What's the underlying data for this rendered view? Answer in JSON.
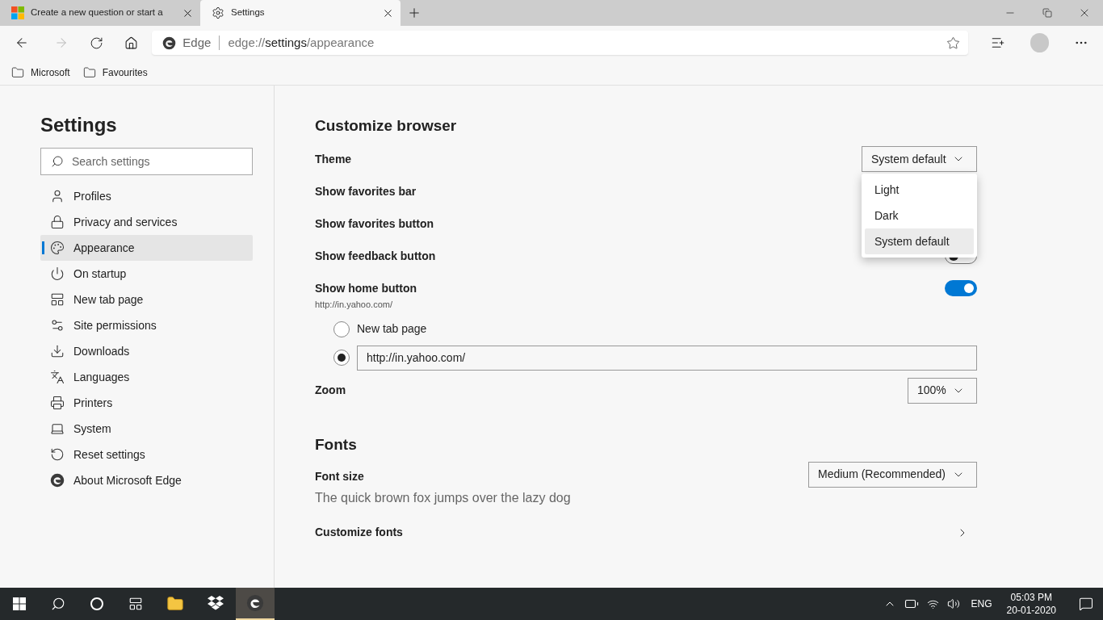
{
  "tabs": [
    {
      "title": "Create a new question or start a",
      "selected": false
    },
    {
      "title": "Settings",
      "selected": true
    }
  ],
  "address_bar": {
    "site_label": "Edge",
    "url_parts": [
      "edge://",
      "settings",
      "/appearance"
    ]
  },
  "favorites_bar": [
    "Microsoft",
    "Favourites"
  ],
  "sidebar": {
    "title": "Settings",
    "search_placeholder": "Search settings",
    "items": [
      {
        "label": "Profiles",
        "selected": false
      },
      {
        "label": "Privacy and services",
        "selected": false
      },
      {
        "label": "Appearance",
        "selected": true
      },
      {
        "label": "On startup",
        "selected": false
      },
      {
        "label": "New tab page",
        "selected": false
      },
      {
        "label": "Site permissions",
        "selected": false
      },
      {
        "label": "Downloads",
        "selected": false
      },
      {
        "label": "Languages",
        "selected": false
      },
      {
        "label": "Printers",
        "selected": false
      },
      {
        "label": "System",
        "selected": false
      },
      {
        "label": "Reset settings",
        "selected": false
      },
      {
        "label": "About Microsoft Edge",
        "selected": false
      }
    ]
  },
  "customize": {
    "heading": "Customize browser",
    "theme": {
      "label": "Theme",
      "value": "System default",
      "options": [
        {
          "label": "Light",
          "selected": false
        },
        {
          "label": "Dark",
          "selected": false
        },
        {
          "label": "System default",
          "selected": true
        }
      ]
    },
    "rows": [
      {
        "kind": "plain",
        "label": "Show favorites bar"
      },
      {
        "kind": "plain",
        "label": "Show favorites button"
      },
      {
        "kind": "toggle",
        "label": "Show feedback button",
        "on": false
      },
      {
        "kind": "toggle",
        "label": "Show home button",
        "on": true,
        "sub": "http://in.yahoo.com/"
      }
    ],
    "home_options": [
      {
        "kind": "label",
        "label": "New tab page",
        "selected": false
      },
      {
        "kind": "field",
        "value": "http://in.yahoo.com/",
        "selected": true
      }
    ],
    "zoom": {
      "label": "Zoom",
      "value": "100%"
    }
  },
  "fonts": {
    "heading": "Fonts",
    "size_label": "Font size",
    "size_value": "Medium (Recommended)",
    "sample": "The quick brown fox jumps over the lazy dog",
    "customize_label": "Customize fonts"
  },
  "tray": {
    "language": "ENG",
    "time": "05:03 PM",
    "date": "20-01-2020"
  }
}
